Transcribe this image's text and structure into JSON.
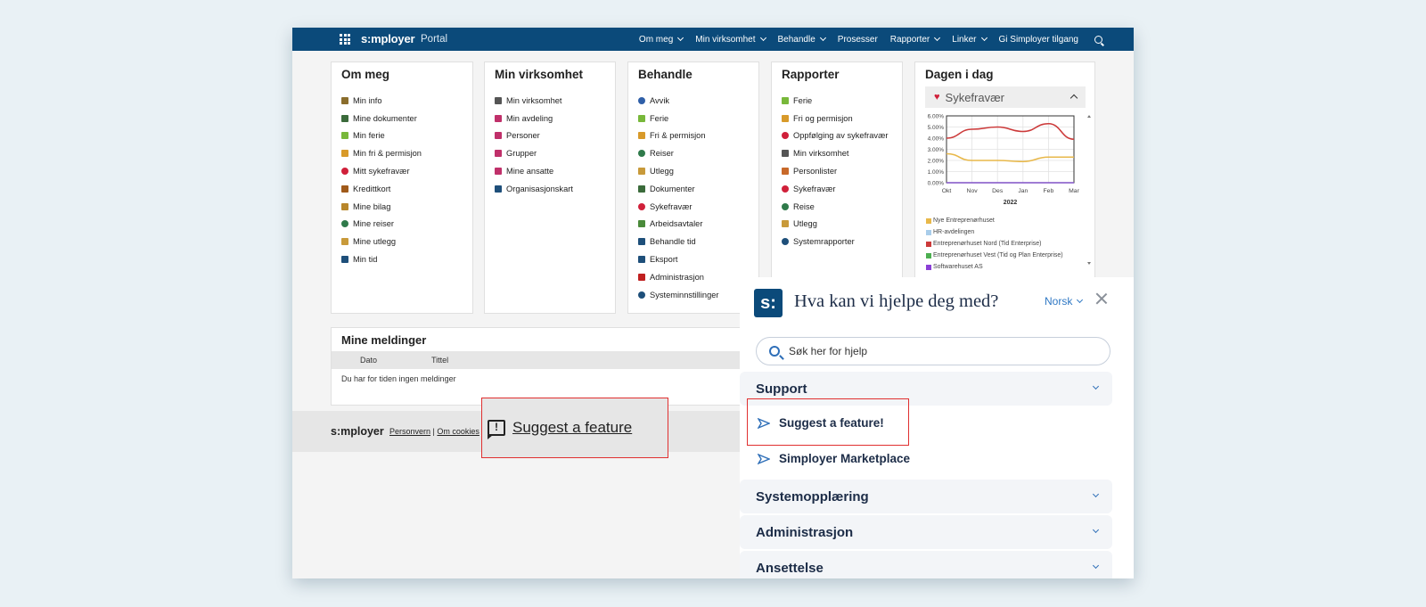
{
  "navbar": {
    "logo": "s:mployer",
    "portal": "Portal",
    "menu": [
      {
        "label": "Om meg",
        "dropdown": true
      },
      {
        "label": "Min virksomhet",
        "dropdown": true
      },
      {
        "label": "Behandle",
        "dropdown": true
      },
      {
        "label": "Prosesser",
        "dropdown": false
      },
      {
        "label": "Rapporter",
        "dropdown": true
      },
      {
        "label": "Linker",
        "dropdown": true
      },
      {
        "label": "Gi Simployer tilgang",
        "dropdown": false
      }
    ]
  },
  "cards": {
    "om_meg": {
      "title": "Om meg",
      "items": [
        "Min info",
        "Mine dokumenter",
        "Min ferie",
        "Min fri & permisjon",
        "Mitt sykefravær",
        "Kredittkort",
        "Mine bilag",
        "Mine reiser",
        "Mine utlegg",
        "Min tid"
      ]
    },
    "min_virksomhet": {
      "title": "Min virksomhet",
      "items": [
        "Min virksomhet",
        "Min avdeling",
        "Personer",
        "Grupper",
        "Mine ansatte",
        "Organisasjonskart"
      ]
    },
    "behandle": {
      "title": "Behandle",
      "items": [
        "Avvik",
        "Ferie",
        "Fri & permisjon",
        "Reiser",
        "Utlegg",
        "Dokumenter",
        "Sykefravær",
        "Arbeidsavtaler",
        "Behandle tid",
        "Eksport",
        "Administrasjon",
        "Systeminnstillinger"
      ]
    },
    "rapporter": {
      "title": "Rapporter",
      "items": [
        "Ferie",
        "Fri og permisjon",
        "Oppfølging av sykefravær",
        "Min virksomhet",
        "Personlister",
        "Sykefravær",
        "Reise",
        "Utlegg",
        "Systemrapporter"
      ]
    },
    "dagen": {
      "title": "Dagen i dag",
      "panel_title": "Sykefravær"
    }
  },
  "chart_data": {
    "type": "line",
    "x": [
      "Okt",
      "Nov",
      "Des",
      "Jan",
      "Feb",
      "Mar"
    ],
    "xlabel": "2022",
    "yticks": [
      "0.00%",
      "1.00%",
      "2.00%",
      "3.00%",
      "4.00%",
      "5.00%",
      "6.00%"
    ],
    "ylim": [
      0,
      6
    ],
    "grid": true,
    "series": [
      {
        "name": "Nye Entreprenørhuset",
        "color": "#e8b84a",
        "values": [
          2.6,
          2.0,
          2.0,
          1.9,
          2.3,
          2.3
        ]
      },
      {
        "name": "HR-avdelingen",
        "color": "#a9cdea",
        "values": [
          0,
          0,
          0,
          0,
          0,
          0
        ]
      },
      {
        "name": "Entreprenørhuset Nord (Tid Enterprise)",
        "color": "#cc3a3a",
        "values": [
          4.0,
          4.8,
          5.0,
          4.6,
          5.3,
          3.9
        ]
      },
      {
        "name": "Entreprenørhuset Vest (Tid og Plan Enterprise)",
        "color": "#4caf50",
        "values": [
          0,
          0,
          0,
          0,
          0,
          0
        ]
      },
      {
        "name": "Softwarehuset AS",
        "color": "#8b3fd6",
        "values": [
          0,
          0,
          0,
          0,
          0,
          0
        ]
      }
    ]
  },
  "meldinger": {
    "title": "Mine meldinger",
    "col_dato": "Dato",
    "col_tittel": "Tittel",
    "empty": "Du har for tiden ingen meldinger"
  },
  "footer": {
    "logo": "s:mployer",
    "link_personvern": "Personvern",
    "separator": "|",
    "link_cookies": "Om cookies"
  },
  "suggest_overlay": {
    "label": "Suggest a feature"
  },
  "help": {
    "logo": "s:",
    "title": "Hva kan vi hjelpe deg med?",
    "language": "Norsk",
    "search_placeholder": "Søk her for hjelp",
    "sections": [
      "Support",
      "Systemopplæring",
      "Administrasjon",
      "Ansettelse"
    ],
    "links": [
      "Suggest a feature!",
      "Simployer Marketplace"
    ]
  },
  "colors": {
    "brand": "#0b4a7a",
    "highlight": "#e03030",
    "link": "#2f78c4"
  }
}
